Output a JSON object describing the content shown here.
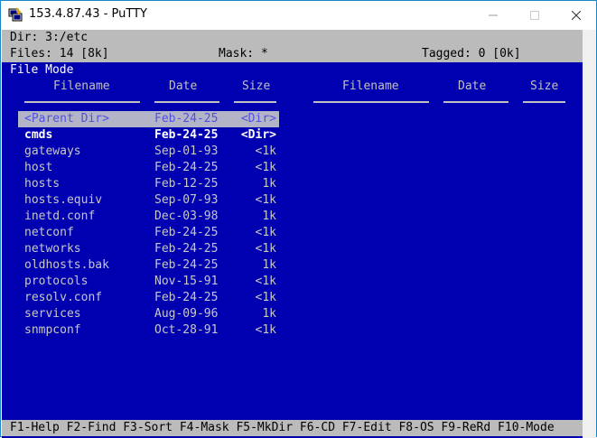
{
  "window": {
    "title": "153.4.87.43 - PuTTY"
  },
  "header": {
    "dir_line": "Dir: 3:/etc",
    "files": "Files: 14 [8k]",
    "mask": "Mask: *",
    "tagged": "Tagged: 0 [0k]"
  },
  "mode_label": "File Mode",
  "columns": {
    "filename": "Filename",
    "date": "Date",
    "size": "Size"
  },
  "files": [
    {
      "name": "<Parent Dir>",
      "date": "Feb-24-25",
      "size": "<Dir>",
      "style": "selected"
    },
    {
      "name": "cmds",
      "date": "Feb-24-25",
      "size": "<Dir>",
      "style": "dir"
    },
    {
      "name": "gateways",
      "date": "Sep-01-93",
      "size": "<1k",
      "style": "file"
    },
    {
      "name": "host",
      "date": "Feb-24-25",
      "size": "<1k",
      "style": "file"
    },
    {
      "name": "hosts",
      "date": "Feb-12-25",
      "size": "1k",
      "style": "file"
    },
    {
      "name": "hosts.equiv",
      "date": "Sep-07-93",
      "size": "<1k",
      "style": "file"
    },
    {
      "name": "inetd.conf",
      "date": "Dec-03-98",
      "size": "1k",
      "style": "file"
    },
    {
      "name": "netconf",
      "date": "Feb-24-25",
      "size": "<1k",
      "style": "file"
    },
    {
      "name": "networks",
      "date": "Feb-24-25",
      "size": "<1k",
      "style": "file"
    },
    {
      "name": "oldhosts.bak",
      "date": "Feb-24-25",
      "size": "1k",
      "style": "file"
    },
    {
      "name": "protocols",
      "date": "Nov-15-91",
      "size": "<1k",
      "style": "file"
    },
    {
      "name": "resolv.conf",
      "date": "Feb-24-25",
      "size": "<1k",
      "style": "file"
    },
    {
      "name": "services",
      "date": "Aug-09-96",
      "size": "1k",
      "style": "file"
    },
    {
      "name": "snmpconf",
      "date": "Oct-28-91",
      "size": "<1k",
      "style": "file"
    }
  ],
  "function_keys": "F1-Help F2-Find F3-Sort F4-Mask F5-MkDir F6-CD F7-Edit F8-OS F9-ReRd F10-Mode",
  "colors": {
    "terminal_bg": "#0000b0",
    "status_bar": "#bbbbbb",
    "selection": "#b4b4c8"
  }
}
